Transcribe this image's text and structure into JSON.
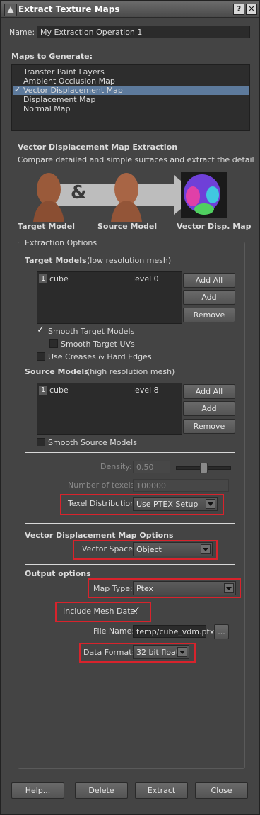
{
  "window": {
    "title": "Extract Texture Maps",
    "help_glyph": "?",
    "close_glyph": "✕"
  },
  "name": {
    "label": "Name:",
    "value": "My Extraction Operation 1"
  },
  "maps": {
    "heading": "Maps to Generate:",
    "items": [
      {
        "label": "Transfer Paint Layers",
        "checked": false,
        "selected": false
      },
      {
        "label": "Ambient Occlusion Map",
        "checked": false,
        "selected": false
      },
      {
        "label": "Vector Displacement Map",
        "checked": true,
        "selected": true
      },
      {
        "label": "Displacement Map",
        "checked": false,
        "selected": false
      },
      {
        "label": "Normal Map",
        "checked": false,
        "selected": false
      }
    ]
  },
  "info": {
    "heading": "Vector Displacement Map Extraction",
    "description": "Compare detailed and simple surfaces and extract the detail",
    "ampersand": "&",
    "target_caption": "Target Model",
    "source_caption": "Source Model",
    "result_caption": "Vector Disp. Map"
  },
  "extraction": {
    "group_label": "Extraction Options",
    "target": {
      "heading": "Target Models",
      "subheading": "(low resolution mesh)",
      "rows": [
        {
          "index": "1",
          "name": "cube",
          "level": "level 0"
        }
      ],
      "add_all": "Add All",
      "add_selected": "Add Selected",
      "remove": "Remove",
      "smooth_models": "Smooth Target Models",
      "smooth_uvs": "Smooth Target UVs",
      "use_creases": "Use Creases & Hard Edges"
    },
    "source": {
      "heading": "Source Models",
      "subheading": "(high resolution mesh)",
      "rows": [
        {
          "index": "1",
          "name": "cube",
          "level": "level 8"
        }
      ],
      "add_all": "Add All",
      "add_selected": "Add Selected",
      "remove": "Remove",
      "smooth_models": "Smooth Source Models"
    },
    "density": {
      "label": "Density:",
      "value": "0.50",
      "slider_fraction": 0.5
    },
    "texels": {
      "label": "Number of texels:",
      "value": "100000"
    },
    "texel_distribution": {
      "label": "Texel Distribution:",
      "value": "Use PTEX Setup"
    }
  },
  "vdm_options": {
    "heading": "Vector Displacement Map Options",
    "vector_space": {
      "label": "Vector Space:",
      "value": "Object"
    }
  },
  "output": {
    "heading": "Output options",
    "map_type": {
      "label": "Map Type:",
      "value": "Ptex"
    },
    "include_mesh": {
      "label": "Include Mesh Data:",
      "checked": true
    },
    "file_name": {
      "label": "File Name:",
      "value": "temp/cube_vdm.ptx",
      "browse": "..."
    },
    "data_format": {
      "label": "Data Format:",
      "value": "32 bit float"
    }
  },
  "buttons": {
    "help": "Help...",
    "delete": "Delete",
    "extract": "Extract",
    "close": "Close"
  },
  "colors": {
    "highlight": "#d8232c",
    "selection": "#5d7a9c"
  }
}
